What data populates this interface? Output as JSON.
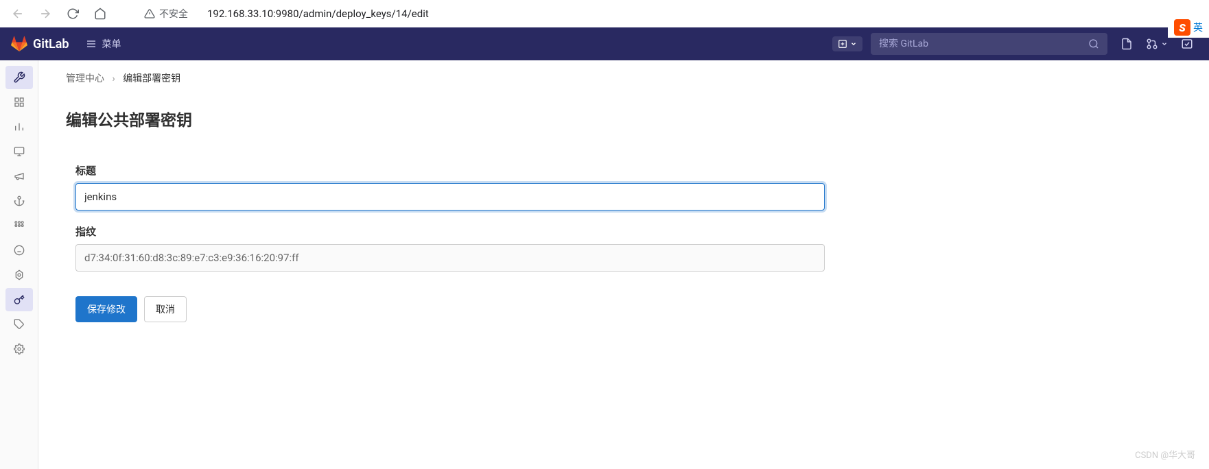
{
  "browser": {
    "security_label": "不安全",
    "url": "192.168.33.10:9980/admin/deploy_keys/14/edit"
  },
  "topnav": {
    "brand": "GitLab",
    "menu_label": "菜单",
    "search_placeholder": "搜索 GitLab"
  },
  "ime": {
    "s": "S",
    "lang": "英"
  },
  "breadcrumb": {
    "root": "管理中心",
    "current": "编辑部署密钥"
  },
  "page": {
    "title": "编辑公共部署密钥"
  },
  "form": {
    "title_label": "标题",
    "title_value": "jenkins",
    "fingerprint_label": "指纹",
    "fingerprint_value": "d7:34:0f:31:60:d8:3c:89:e7:c3:e9:36:16:20:97:ff",
    "save_label": "保存修改",
    "cancel_label": "取消"
  },
  "watermark": "CSDN @华大哥"
}
